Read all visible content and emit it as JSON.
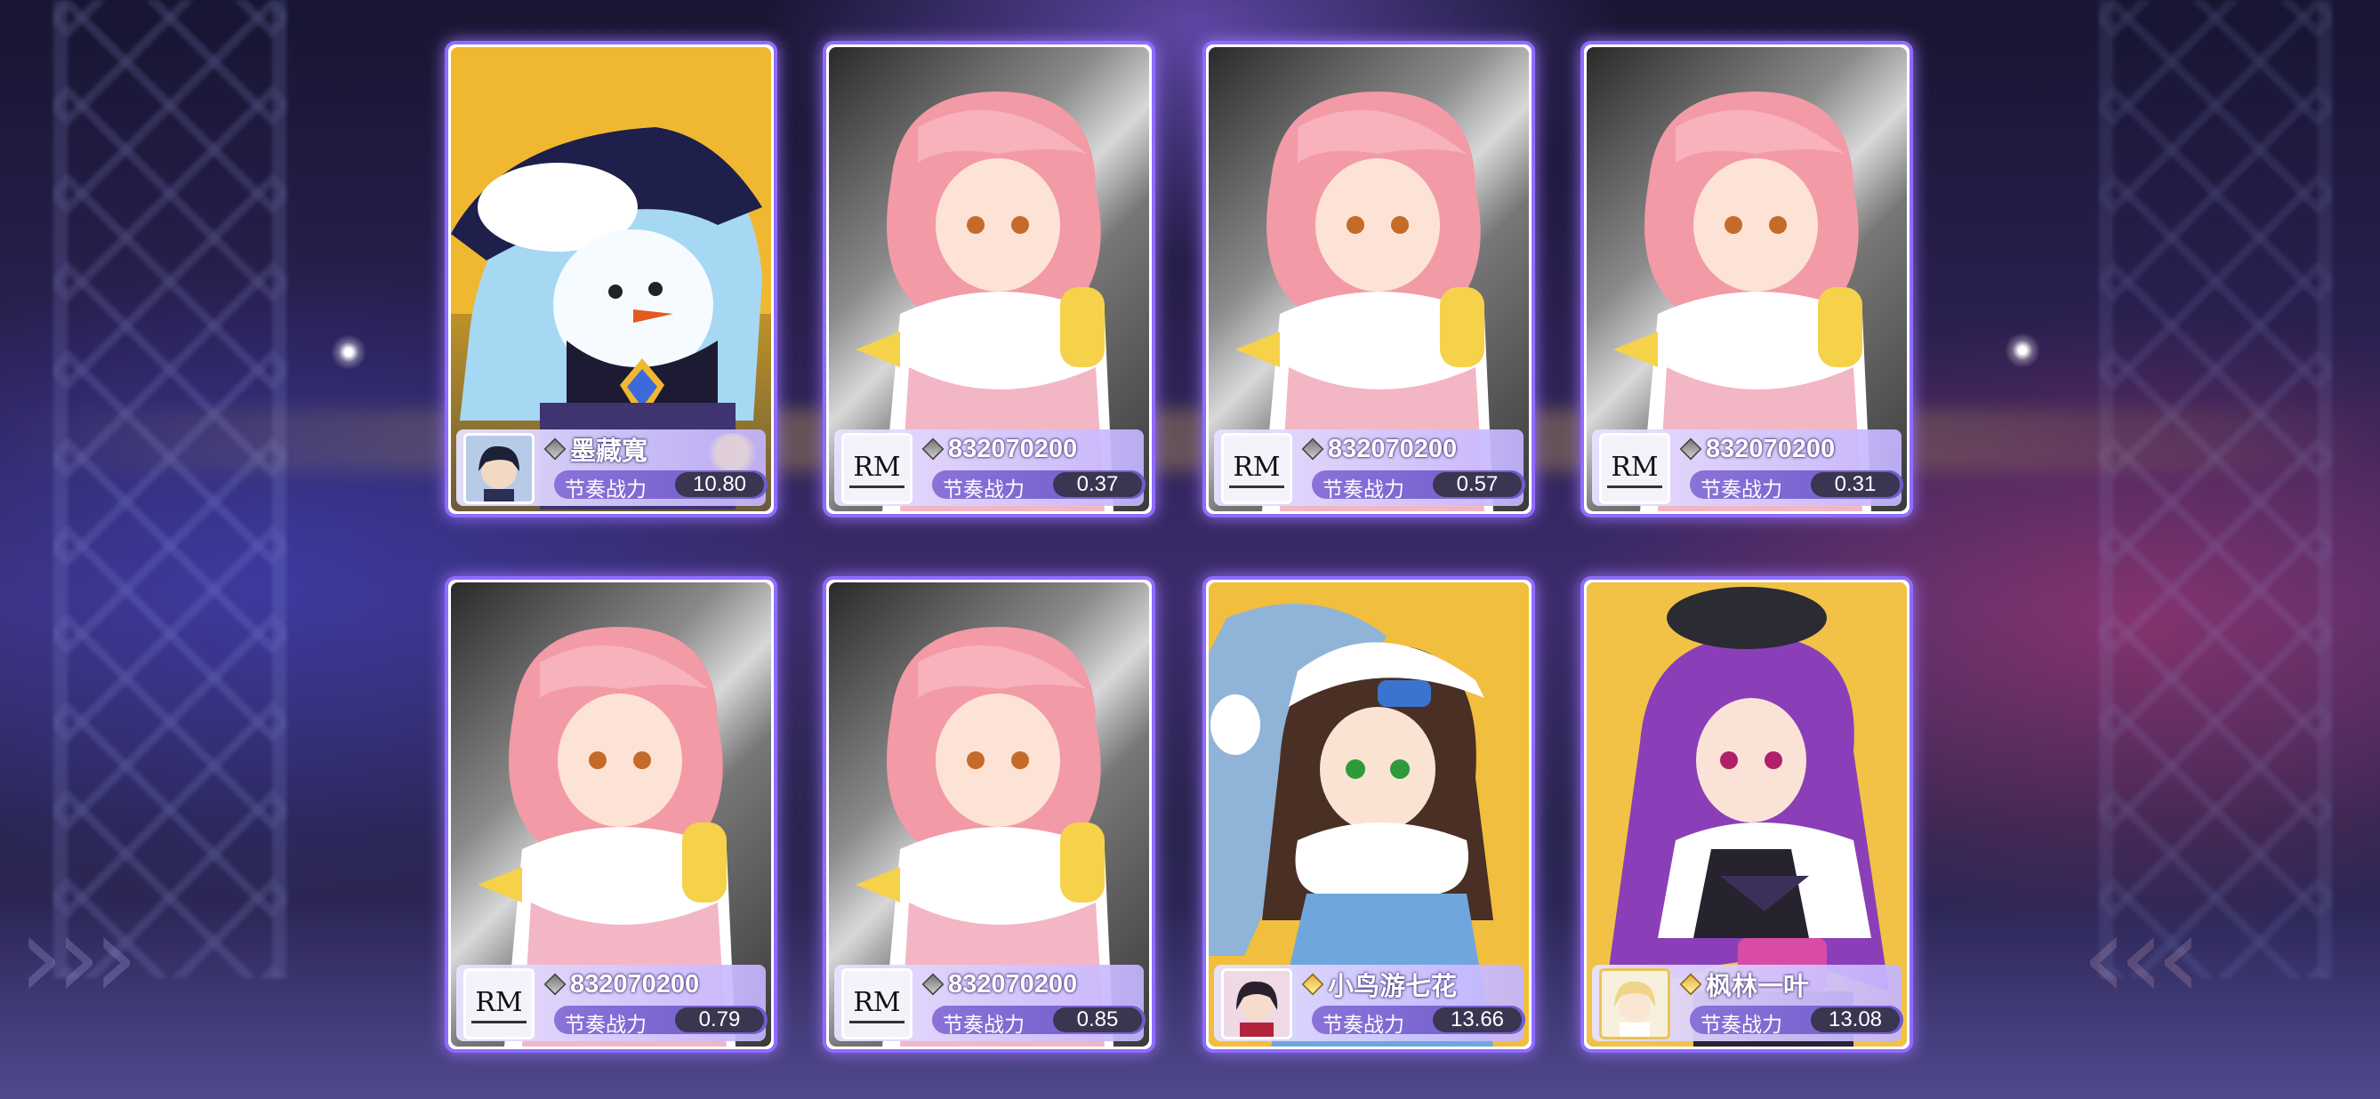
{
  "cards": [
    {
      "art": "witch-snowman",
      "avatar": "dark-hair-boy",
      "gem": "silver-gem-icon",
      "name": "墨藏寬",
      "power_label": "节奏战力",
      "power_value": "10.80"
    },
    {
      "art": "pink-hair-girl",
      "avatar": "rm-logo",
      "avatar_text": "RM",
      "gem": "silver-gem-icon",
      "name": "832070200",
      "power_label": "节奏战力",
      "power_value": "0.37"
    },
    {
      "art": "pink-hair-girl",
      "avatar": "rm-logo",
      "avatar_text": "RM",
      "gem": "silver-gem-icon",
      "name": "832070200",
      "power_label": "节奏战力",
      "power_value": "0.57"
    },
    {
      "art": "pink-hair-girl",
      "avatar": "rm-logo",
      "avatar_text": "RM",
      "gem": "silver-gem-icon",
      "name": "832070200",
      "power_label": "节奏战力",
      "power_value": "0.31"
    },
    {
      "art": "pink-hair-girl",
      "avatar": "rm-logo",
      "avatar_text": "RM",
      "gem": "silver-gem-icon",
      "name": "832070200",
      "power_label": "节奏战力",
      "power_value": "0.79"
    },
    {
      "art": "pink-hair-girl",
      "avatar": "rm-logo",
      "avatar_text": "RM",
      "gem": "silver-gem-icon",
      "name": "832070200",
      "power_label": "节奏战力",
      "power_value": "0.85"
    },
    {
      "art": "brown-hair-winter-girl",
      "avatar": "red-dark-hair-girl",
      "gem": "gold-gem-icon",
      "name": "小鸟游七花",
      "power_label": "节奏战力",
      "power_value": "13.66"
    },
    {
      "art": "purple-hair-idol",
      "avatar": "blonde-boy",
      "gem": "gold-gem-icon",
      "name": "枫林一叶",
      "power_label": "节奏战力",
      "power_value": "13.08"
    }
  ],
  "colors": {
    "card_border": "#8f6cff",
    "power_badge": "#3a3550",
    "info_bar": "#c4b4ff"
  }
}
